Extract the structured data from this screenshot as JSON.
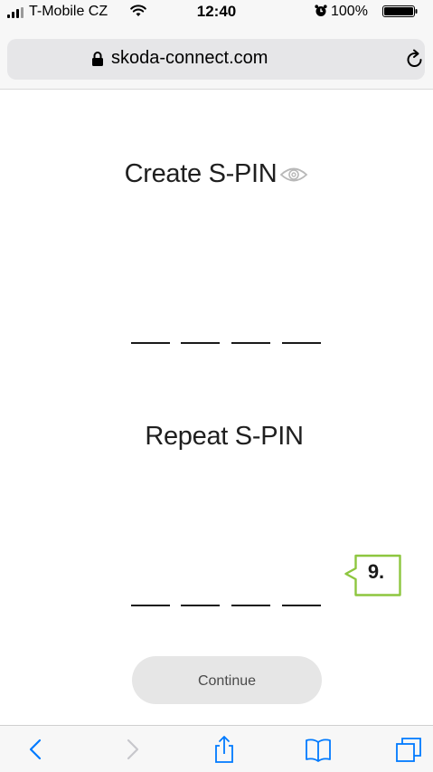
{
  "status_bar": {
    "carrier": "T-Mobile CZ",
    "time": "12:40",
    "battery_percent": "100%",
    "icons": [
      "signal-icon",
      "wifi-icon",
      "alarm-icon",
      "battery-icon"
    ]
  },
  "browser": {
    "url": "skoda-connect.com",
    "icons": [
      "lock-icon",
      "reload-icon"
    ]
  },
  "form": {
    "create_title": "Create S-PIN",
    "repeat_title": "Repeat S-PIN",
    "create_digits": [
      "",
      "",
      "",
      ""
    ],
    "repeat_digits": [
      "",
      "",
      "",
      ""
    ],
    "continue_label": "Continue",
    "icons": [
      "eye-icon"
    ]
  },
  "annotation": {
    "step_label": "9.",
    "border_color": "#8dc63f"
  },
  "toolbar": {
    "icons": [
      "back-icon",
      "forward-icon",
      "share-icon",
      "bookmarks-icon",
      "tabs-icon"
    ],
    "accent": "#007aff",
    "disabled": "#c7c7cc"
  }
}
